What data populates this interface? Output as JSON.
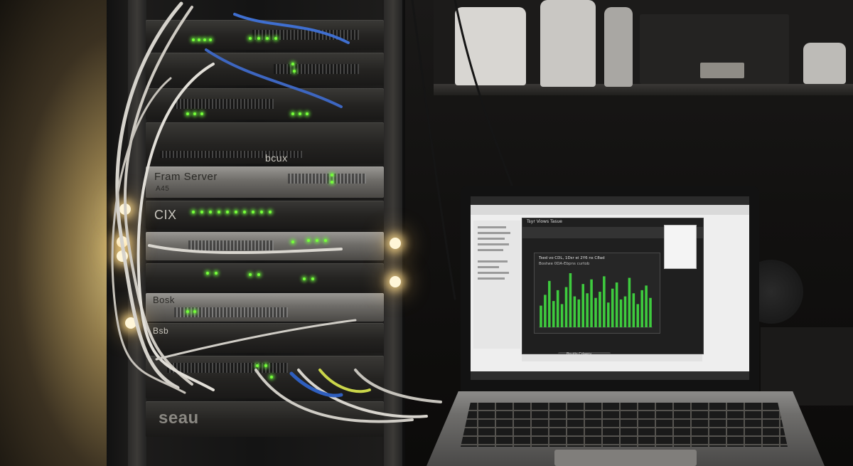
{
  "rack": {
    "labels": [
      "bcux",
      "Fram Server",
      "A45",
      "CIX",
      "Bosk",
      "Bsb",
      "seau"
    ]
  },
  "laptop_screen": {
    "window_title": "Tsyr Viows Tasue",
    "chart_heading": "Tsed vo CDL, 1Dsr ei  2Y6 ns C8ad",
    "chart_subheading": "Bostwe 0DA-Ebpns curtob",
    "button_label": "Bnutis Cdaery",
    "chart_data": {
      "type": "bar",
      "series_color": "#3ecb3e",
      "values": [
        28,
        42,
        60,
        34,
        48,
        30,
        52,
        70,
        40,
        36,
        56,
        44,
        62,
        38,
        46,
        66,
        32,
        50,
        58,
        36,
        40,
        64,
        44,
        30,
        48,
        54,
        38
      ]
    }
  }
}
